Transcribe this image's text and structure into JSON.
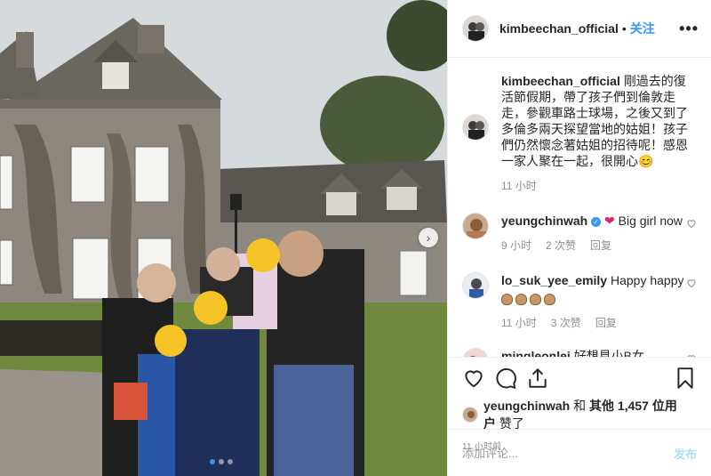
{
  "post": {
    "username": "kimbeechan_official",
    "follow_label": "关注",
    "separator": "•",
    "more_label": "•••",
    "carousel_next": "›"
  },
  "caption": {
    "username": "kimbeechan_official",
    "text": "剛過去的復活節假期，帶了孩子們到倫敦走走，參觀車路士球場，之後又到了多倫多兩天探望當地的姑姐！孩子們仍然懷念著姑姐的招待呢！感恩一家人聚在一起，很開心",
    "emoji": "😊",
    "time": "11 小时"
  },
  "comments": [
    {
      "username": "yeungchinwah",
      "verified": true,
      "heart": "❤",
      "text": "Big girl now",
      "time": "9 小时",
      "likes": "2 次赞",
      "reply": "回复"
    },
    {
      "username": "lo_suk_yee_emily",
      "text": "Happy happy",
      "clap_count": 4,
      "time": "11 小时",
      "likes": "3 次赞",
      "reply": "回复"
    },
    {
      "username": "mingleonlei",
      "text": "好想見小B女"
    }
  ],
  "likes": {
    "user": "yeungchinwah",
    "and": "和",
    "others": "其他 1,457 位用户",
    "suffix": "赞了"
  },
  "timestamp": "11 小时前",
  "comment_box": {
    "placeholder": "添加评论...",
    "post_label": "发布"
  },
  "carousel": {
    "slides": 3,
    "active_index": 0
  },
  "colors": {
    "accent": "#3897f0",
    "meta": "#8e8e8e",
    "post_disabled": "#b2dffc"
  },
  "icons": [
    "heart-icon",
    "comment-icon",
    "share-icon",
    "bookmark-icon"
  ]
}
